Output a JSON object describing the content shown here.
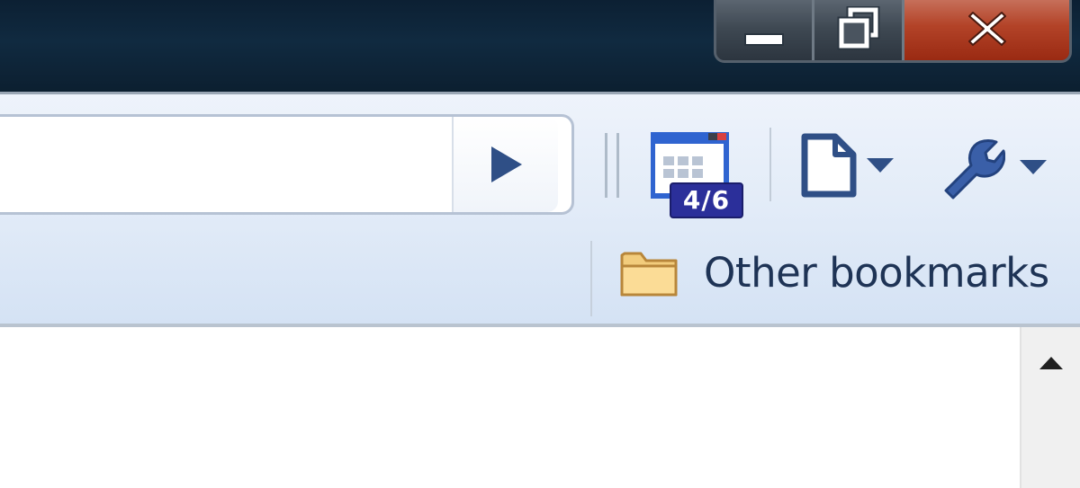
{
  "window": {
    "caption_buttons": [
      {
        "name": "minimize",
        "icon": "minimize-icon"
      },
      {
        "name": "restore",
        "icon": "restore-icon"
      },
      {
        "name": "close",
        "icon": "close-icon"
      }
    ],
    "close_color": "#b34328"
  },
  "toolbar": {
    "omnibox": {
      "value": "",
      "placeholder": ""
    },
    "go_icon": "play-arrow-icon",
    "tab_counter": {
      "icon": "tab-grid-icon",
      "badge": "4/6",
      "badge_color": "#2b2f9a"
    },
    "page_menu_icon": "page-icon",
    "wrench_menu_icon": "wrench-icon",
    "accent": "#2f4f86"
  },
  "bookmarks_bar": {
    "other_bookmarks": {
      "label": "Other bookmarks",
      "icon": "folder-icon"
    }
  },
  "scrollbar": {
    "up_icon": "scroll-up-arrow-icon"
  }
}
